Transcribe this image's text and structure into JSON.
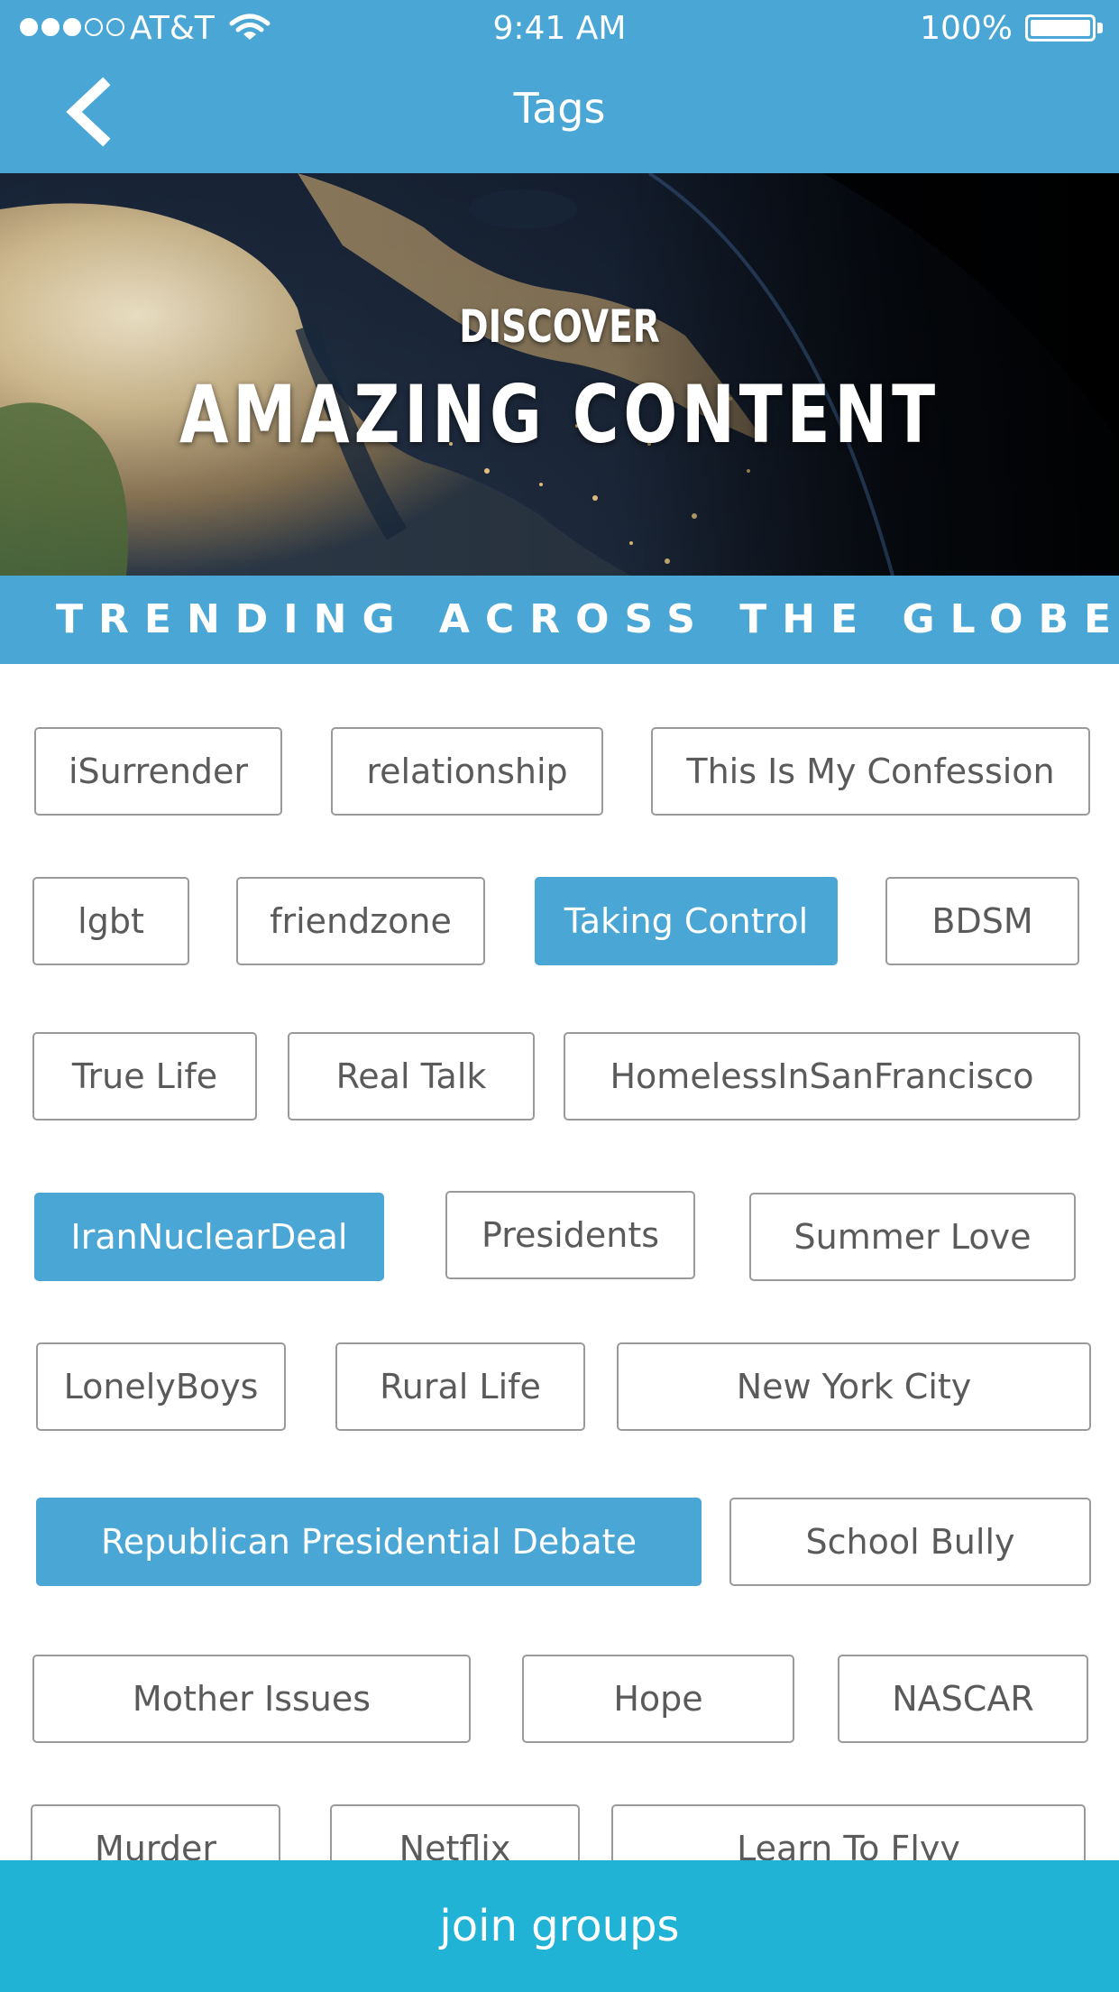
{
  "status_bar": {
    "carrier": "AT&T",
    "time": "9:41 AM",
    "battery": "100%",
    "battery_level": 1.0,
    "signal_bars_filled": 3,
    "signal_bars_total": 5
  },
  "nav": {
    "title": "Tags",
    "back_icon": "chevron-left-icon"
  },
  "hero": {
    "line1": "DISCOVER",
    "line2": "AMAZING CONTENT"
  },
  "section": {
    "title": "TRENDING ACROSS THE GLOBE"
  },
  "tags": [
    {
      "label": "iSurrender",
      "selected": false
    },
    {
      "label": "relationship",
      "selected": false
    },
    {
      "label": "This Is My Confession",
      "selected": false
    },
    {
      "label": "lgbt",
      "selected": false
    },
    {
      "label": "friendzone",
      "selected": false
    },
    {
      "label": "Taking Control",
      "selected": true
    },
    {
      "label": "BDSM",
      "selected": false
    },
    {
      "label": "True Life",
      "selected": false
    },
    {
      "label": "Real Talk",
      "selected": false
    },
    {
      "label": "HomelessInSanFrancisco",
      "selected": false
    },
    {
      "label": "IranNuclearDeal",
      "selected": true
    },
    {
      "label": "Presidents",
      "selected": false
    },
    {
      "label": "Summer Love",
      "selected": false
    },
    {
      "label": "LonelyBoys",
      "selected": false
    },
    {
      "label": "Rural Life",
      "selected": false
    },
    {
      "label": "New York City",
      "selected": false
    },
    {
      "label": "Republican Presidential Debate",
      "selected": true
    },
    {
      "label": "School Bully",
      "selected": false
    },
    {
      "label": "Mother Issues",
      "selected": false
    },
    {
      "label": "Hope",
      "selected": false
    },
    {
      "label": "NASCAR",
      "selected": false
    },
    {
      "label": "Murder",
      "selected": false
    },
    {
      "label": "Netflix",
      "selected": false
    },
    {
      "label": "Learn To Flyy",
      "selected": false
    }
  ],
  "footer": {
    "button_label": "join groups"
  },
  "colors": {
    "header": "#4aa6d4",
    "selected_tag": "#4aa6d4",
    "join_bar": "#20b3d5",
    "tag_border": "#9a9a9a",
    "tag_text": "#5a5a5a"
  }
}
